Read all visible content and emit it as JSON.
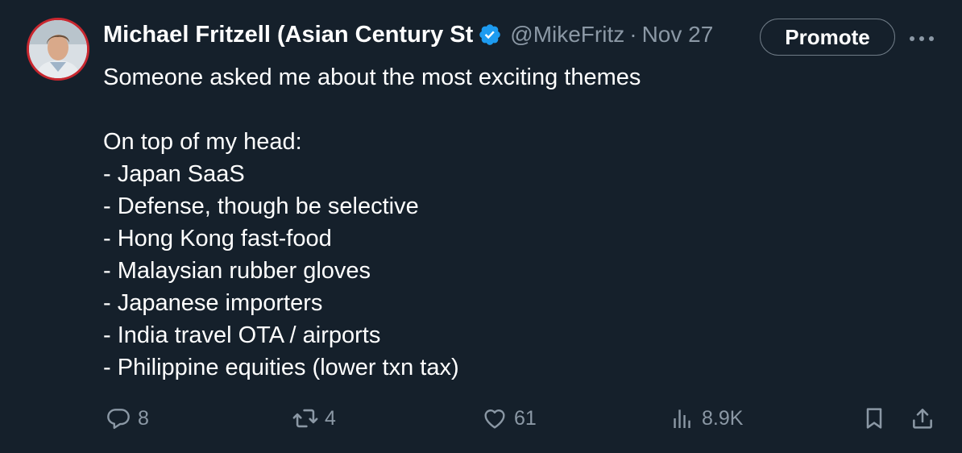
{
  "author": {
    "name": "Michael Fritzell (Asian Century St",
    "handle": "@MikeFritz",
    "separator": "·",
    "date": "Nov 27"
  },
  "header": {
    "promote_label": "Promote"
  },
  "tweet": {
    "lines": [
      "Someone asked me about the most exciting themes",
      "",
      "On top of my head:",
      "- Japan SaaS",
      "- Defense, though be selective",
      "- Hong Kong fast-food",
      "- Malaysian rubber gloves",
      "- Japanese importers",
      "- India travel OTA / airports",
      "- Philippine equities (lower txn tax)"
    ]
  },
  "actions": {
    "replies": "8",
    "reposts": "4",
    "likes": "61",
    "views": "8.9K"
  },
  "icons": [
    "avatar",
    "verified-badge-icon",
    "more-icon",
    "reply-icon",
    "repost-icon",
    "like-icon",
    "views-icon",
    "bookmark-icon",
    "share-icon"
  ],
  "colors": {
    "background": "#15202b",
    "text": "#ffffff",
    "muted": "#8b98a5",
    "verified": "#1d9bf0",
    "avatar_ring": "#c8272f"
  }
}
